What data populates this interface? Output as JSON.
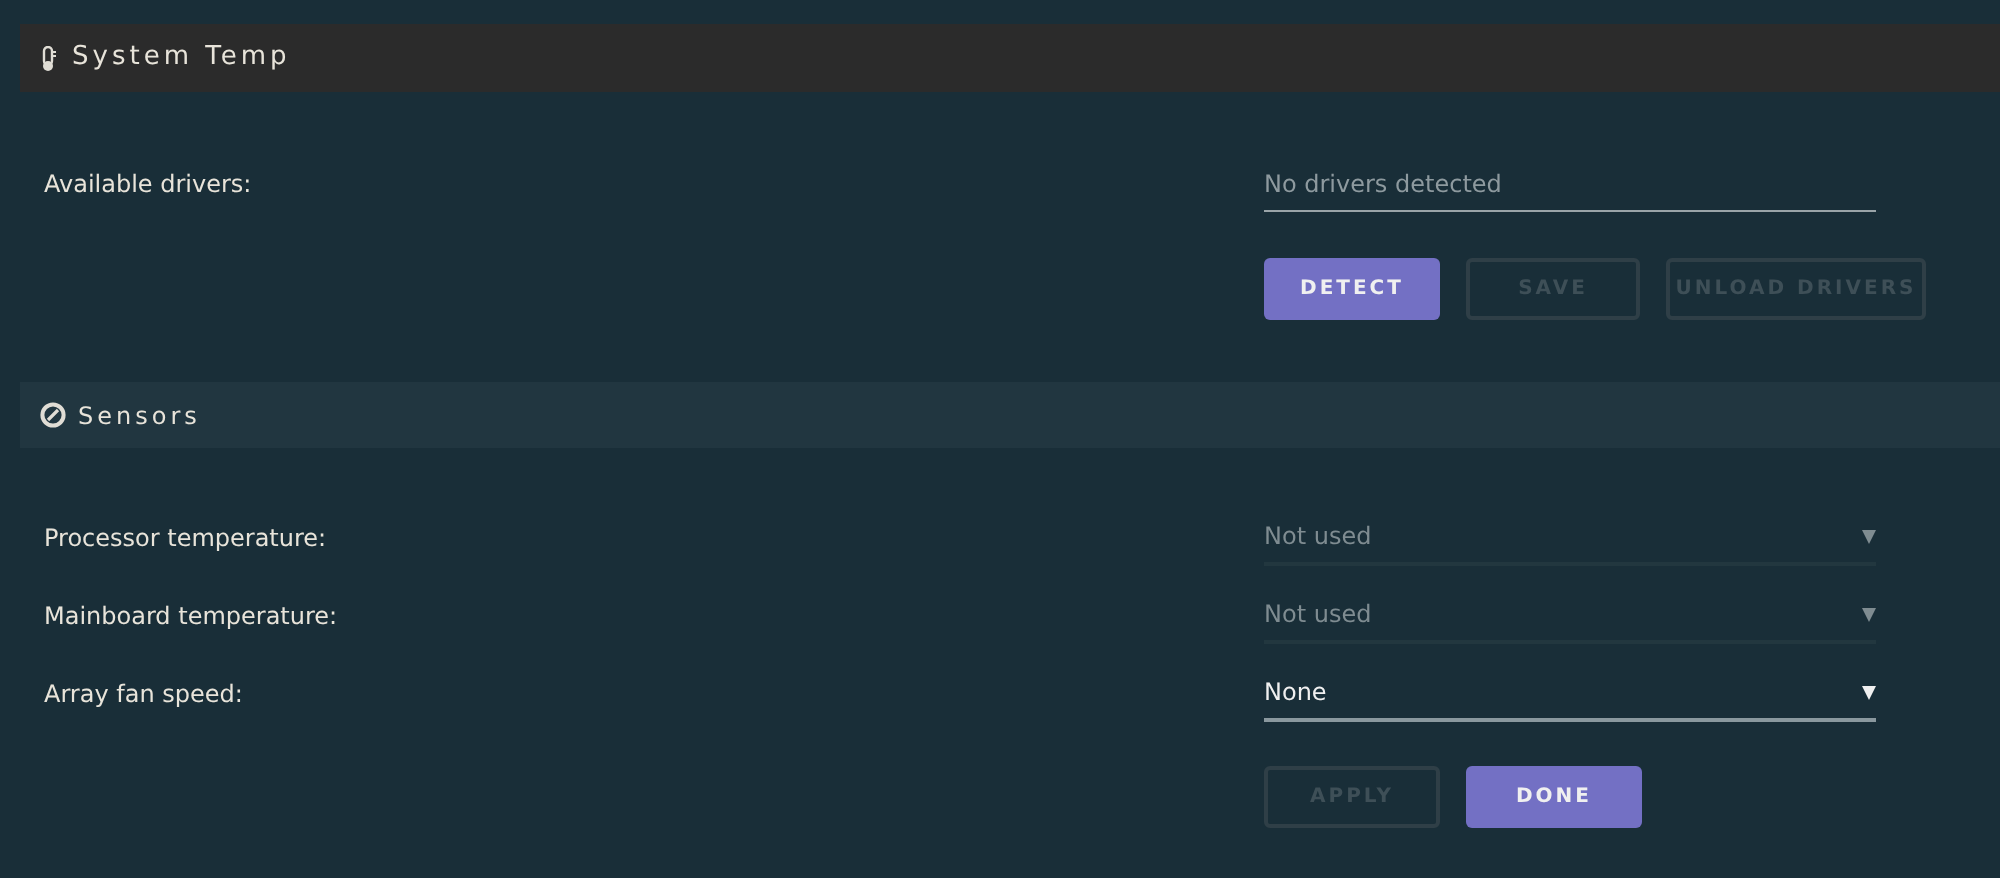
{
  "system_temp": {
    "title": "System Temp",
    "drivers_label": "Available drivers:",
    "drivers_value": "No drivers detected",
    "buttons": [
      {
        "label": "DETECT",
        "disabled": false
      },
      {
        "label": "SAVE",
        "disabled": true
      },
      {
        "label": "UNLOAD DRIVERS",
        "disabled": true
      }
    ]
  },
  "sensors": {
    "title": "Sensors",
    "rows": [
      {
        "label": "Processor temperature:",
        "value": "Not used",
        "disabled": true
      },
      {
        "label": "Mainboard temperature:",
        "value": "Not used",
        "disabled": true
      },
      {
        "label": "Array fan speed:",
        "value": "None",
        "disabled": false
      }
    ],
    "buttons": [
      {
        "label": "APPLY",
        "disabled": true
      },
      {
        "label": "DONE",
        "disabled": false
      }
    ]
  }
}
